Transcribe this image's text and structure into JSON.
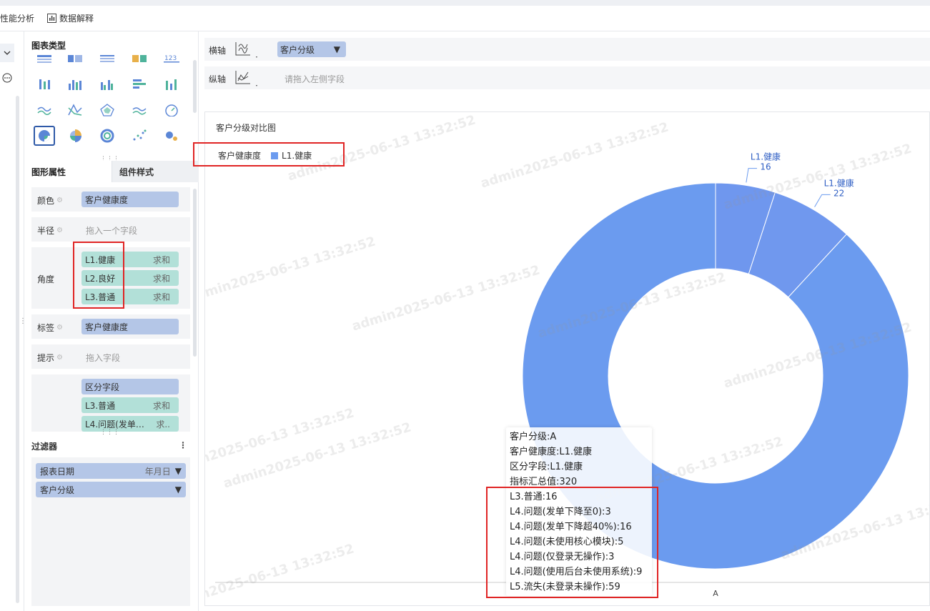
{
  "toolbar": {
    "perf_label": "性能分析",
    "data_label": "数据解释"
  },
  "panel": {
    "chart_types_title": "图表类型",
    "tabs": {
      "active": "图形属性",
      "inactive": "组件样式"
    },
    "color": {
      "label": "颜色",
      "field": "客户健康度"
    },
    "radius": {
      "label": "半径",
      "placeholder": "拖入一个字段"
    },
    "angle": {
      "label": "角度",
      "fields": [
        {
          "name": "L1.健康",
          "agg": "求和"
        },
        {
          "name": "L2.良好",
          "agg": "求和"
        },
        {
          "name": "L3.普通",
          "agg": "求和"
        }
      ]
    },
    "tag": {
      "label": "标签",
      "field": "客户健康度"
    },
    "hint": {
      "label": "提示",
      "placeholder": "拖入字段"
    },
    "extra": {
      "fields": [
        {
          "name": "区分字段",
          "agg": ""
        },
        {
          "name": "L3.普通",
          "agg": "求和"
        },
        {
          "name": "L4.问题(发单…",
          "agg": "求.."
        }
      ]
    },
    "filter": {
      "title": "过滤器",
      "items": [
        {
          "name": "报表日期",
          "extra": "年月日"
        },
        {
          "name": "客户分级",
          "extra": ""
        }
      ]
    }
  },
  "axes": {
    "x": {
      "label": "横轴",
      "field": "客户分级"
    },
    "y": {
      "label": "纵轴",
      "placeholder": "请拖入左侧字段"
    }
  },
  "chart": {
    "title": "客户分级对比图",
    "legend_title": "客户健康度",
    "legend_item": "L1.健康",
    "x_tick": "A",
    "watermark": "admin2025-06-13 13:32:52"
  },
  "chart_data": {
    "type": "pie",
    "categories": [
      "L1.健康",
      "L1.健康",
      "L1.健康"
    ],
    "labels": [
      {
        "name": "L1.健康",
        "value": "16"
      },
      {
        "name": "L1.健康",
        "value": "22"
      }
    ],
    "values": [
      16,
      22,
      282
    ],
    "total": 320,
    "x_category": "A",
    "color": "#6b9bef"
  },
  "tooltip": {
    "lines": [
      "客户分级:A",
      "客户健康度:L1.健康",
      "区分字段:L1.健康",
      "指标汇总值:320",
      "L3.普通:16",
      "L4.问题(发单下降至0):3",
      "L4.问题(发单下降超40%):16",
      "L4.问题(未使用核心模块):5",
      "L4.问题(仅登录无操作):3",
      "L4.问题(使用后台未使用系统):9",
      "L5.流失(未登录未操作):59"
    ]
  },
  "colors": {
    "accent": "#6b9bef",
    "pill_blue": "#b4c6e7",
    "pill_green": "#b2e0d8",
    "highlight": "#e02424"
  }
}
